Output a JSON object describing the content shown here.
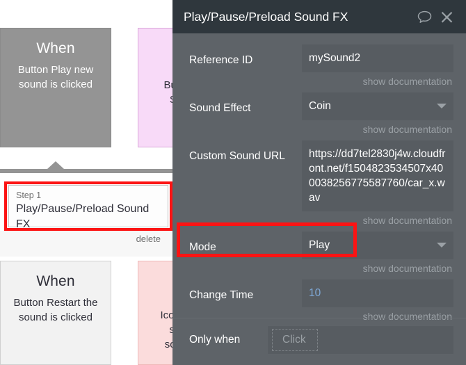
{
  "canvas": {
    "workflows": [
      {
        "event": {
          "title": "When",
          "subtitle": "Button Play new sound is clicked",
          "state": "selected"
        },
        "action": {
          "text": "Butto\nSo",
          "color": "#f8daf8"
        },
        "step": {
          "label": "Step 1",
          "title": "Play/Pause/Preload Sound FX",
          "delete_label": "delete",
          "highlighted": true
        }
      },
      {
        "event": {
          "title": "When",
          "subtitle": "Button Restart the sound is clicked",
          "state": "plain"
        },
        "action": {
          "text": "Icon fa\nsla\nsoun",
          "color": "#fbdcdc"
        }
      }
    ]
  },
  "panel": {
    "title": "Play/Pause/Preload Sound FX",
    "icons": {
      "comment": "comment-icon",
      "close": "close-icon"
    },
    "doc_link_label": "show documentation",
    "fields": [
      {
        "label": "Reference ID",
        "value": "mySound2",
        "type": "text",
        "has_caret": false,
        "has_doc_link": true
      },
      {
        "label": "Sound Effect",
        "value": "Coin",
        "type": "dropdown",
        "has_caret": true,
        "has_doc_link": true
      },
      {
        "label": "Custom Sound URL",
        "value": "https://dd7tel2830j4w.cloudfront.net/f1504823534507x400038256775587760/car_x.wav",
        "type": "text",
        "has_caret": false,
        "has_doc_link": true
      },
      {
        "label": "Mode",
        "value": "Play",
        "type": "dropdown",
        "has_caret": true,
        "has_doc_link": true,
        "highlighted": true
      },
      {
        "label": "Change Time",
        "value": "10",
        "type": "text",
        "value_style": "blue",
        "has_caret": false,
        "has_doc_link": true
      }
    ],
    "only_when": {
      "label": "Only when",
      "placeholder": "Click"
    }
  },
  "colors": {
    "panel_bg": "#5e6368",
    "titlebar_bg": "#2f373d",
    "input_bg": "#575c61",
    "highlight_red": "#fc1414",
    "event_selected": "#949494",
    "value_blue": "#7fa9d8"
  }
}
